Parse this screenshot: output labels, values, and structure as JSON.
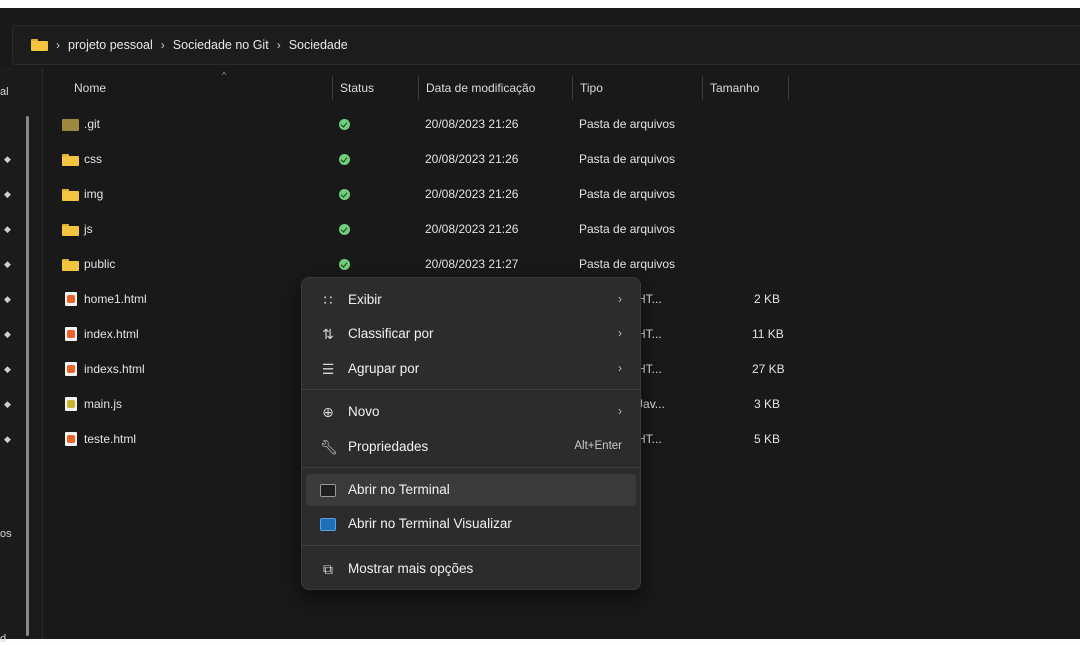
{
  "breadcrumb": [
    "projeto pessoal",
    "Sociedade no Git",
    "Sociedade"
  ],
  "columns": {
    "nome": "Nome",
    "status": "Status",
    "data": "Data de modificação",
    "tipo": "Tipo",
    "tamanho": "Tamanho"
  },
  "left_pane_fragments": [
    "al",
    "os",
    "d"
  ],
  "rows": [
    {
      "name": ".git",
      "icon": "folder-icon",
      "status": "synced",
      "date": "20/08/2023 21:26",
      "tipo": "Pasta de arquivos",
      "size": ""
    },
    {
      "name": "css",
      "icon": "folder-icon",
      "status": "synced",
      "date": "20/08/2023 21:26",
      "tipo": "Pasta de arquivos",
      "size": ""
    },
    {
      "name": "img",
      "icon": "folder-icon",
      "status": "synced",
      "date": "20/08/2023 21:26",
      "tipo": "Pasta de arquivos",
      "size": ""
    },
    {
      "name": "js",
      "icon": "folder-icon",
      "status": "synced",
      "date": "20/08/2023 21:26",
      "tipo": "Pasta de arquivos",
      "size": ""
    },
    {
      "name": "public",
      "icon": "folder-icon",
      "status": "synced",
      "date": "20/08/2023 21:27",
      "tipo": "Pasta de arquivos",
      "size": ""
    },
    {
      "name": "home1.html",
      "icon": "html-file-icon",
      "status": "",
      "date": "",
      "tipo": "nte HT...",
      "size": "2 KB"
    },
    {
      "name": "index.html",
      "icon": "html-file-icon",
      "status": "",
      "date": "",
      "tipo": "nte HT...",
      "size": "11 KB"
    },
    {
      "name": "indexs.html",
      "icon": "html-file-icon",
      "status": "",
      "date": "",
      "tipo": "nte HT...",
      "size": "27 KB"
    },
    {
      "name": "main.js",
      "icon": "js-file-icon",
      "status": "",
      "date": "",
      "tipo": "nte Jav...",
      "size": "3 KB"
    },
    {
      "name": "teste.html",
      "icon": "html-file-icon",
      "status": "",
      "date": "",
      "tipo": "nte HT...",
      "size": "5 KB"
    }
  ],
  "context_menu": {
    "exibir": "Exibir",
    "classificar": "Classificar por",
    "agrupar": "Agrupar por",
    "novo": "Novo",
    "propriedades": "Propriedades",
    "propriedades_shortcut": "Alt+Enter",
    "abrir_terminal": "Abrir no Terminal",
    "abrir_terminal_vis": "Abrir no Terminal Visualizar",
    "mostrar_mais": "Mostrar mais opções"
  },
  "colors": {
    "background": "#191919",
    "menu_bg": "#2c2c2c",
    "folder": "#f3c43f",
    "status_ok": "#6fcf7a"
  }
}
